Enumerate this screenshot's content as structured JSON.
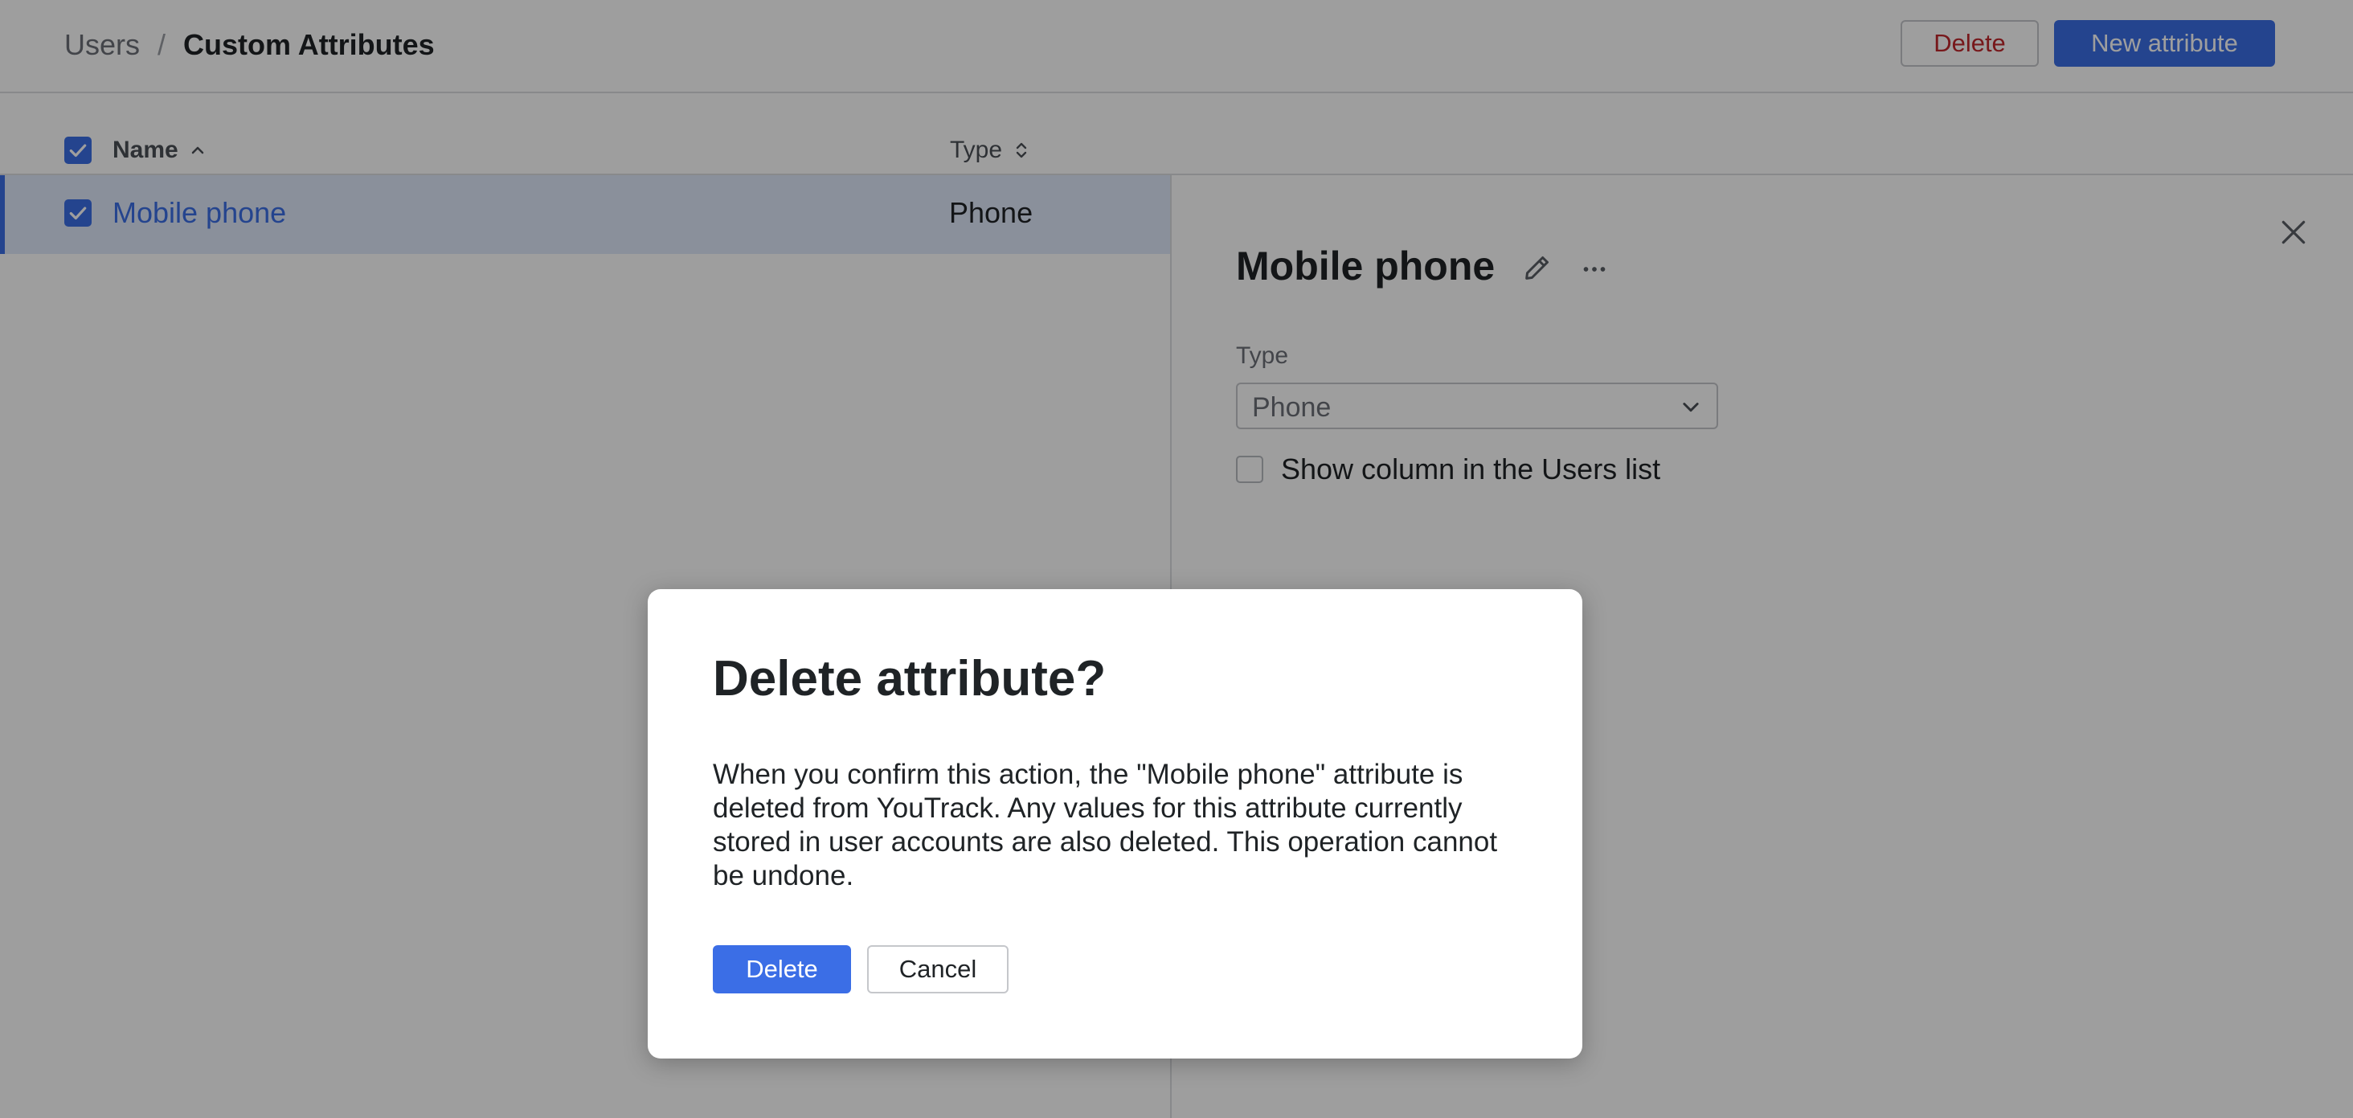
{
  "header": {
    "breadcrumb_parent": "Users",
    "breadcrumb_separator": "/",
    "breadcrumb_current": "Custom Attributes",
    "delete_label": "Delete",
    "new_attribute_label": "New attribute"
  },
  "table": {
    "columns": [
      {
        "label": "Name",
        "sort": "ascending"
      },
      {
        "label": "Type",
        "sort": "unsorted"
      }
    ],
    "rows": [
      {
        "name": "Mobile phone",
        "type": "Phone",
        "selected": true
      }
    ]
  },
  "detail": {
    "title": "Mobile phone",
    "type_label": "Type",
    "type_value": "Phone",
    "show_column_label": "Show column in the Users list",
    "show_column_checked": false
  },
  "modal": {
    "title": "Delete attribute?",
    "body": "When you confirm this action, the \"Mobile phone\" attribute is deleted from YouTrack. Any values for this attribute currently stored in user accounts are also deleted. This operation cannot be undone.",
    "confirm_label": "Delete",
    "cancel_label": "Cancel"
  },
  "icons": {
    "select_all_checkbox": "checkbox-checked-icon",
    "row_checkbox": "checkbox-checked-icon",
    "name_sort": "chevron-up-icon",
    "type_sort": "sort-icon",
    "close": "close-icon",
    "edit": "pencil-icon",
    "more": "more-horizontal-icon",
    "dropdown": "chevron-down-icon"
  },
  "colors": {
    "accent": "#3b6ee6",
    "danger": "#c0272d",
    "selected_row": "#dfe8fb"
  }
}
